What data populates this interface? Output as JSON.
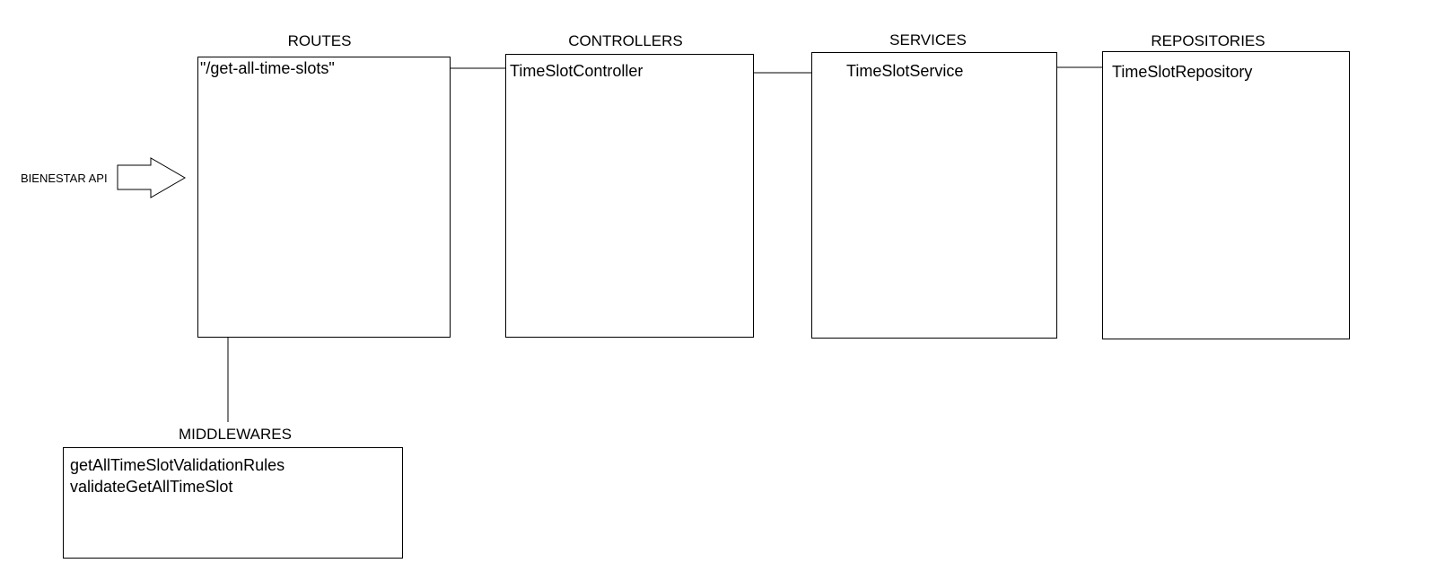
{
  "entry": {
    "label": "BIENESTAR API"
  },
  "layers": {
    "routes": {
      "title": "ROUTES",
      "item": "\"/get-all-time-slots\""
    },
    "controllers": {
      "title": "CONTROLLERS",
      "item": "TimeSlotController"
    },
    "services": {
      "title": "SERVICES",
      "item": "TimeSlotService"
    },
    "repositories": {
      "title": "REPOSITORIES",
      "item": "TimeSlotRepository"
    }
  },
  "middlewares": {
    "title": "MIDDLEWARES",
    "items": [
      "getAllTimeSlotValidationRules",
      "validateGetAllTimeSlot"
    ]
  },
  "colors": {
    "stroke": "#000000",
    "background": "#ffffff"
  }
}
